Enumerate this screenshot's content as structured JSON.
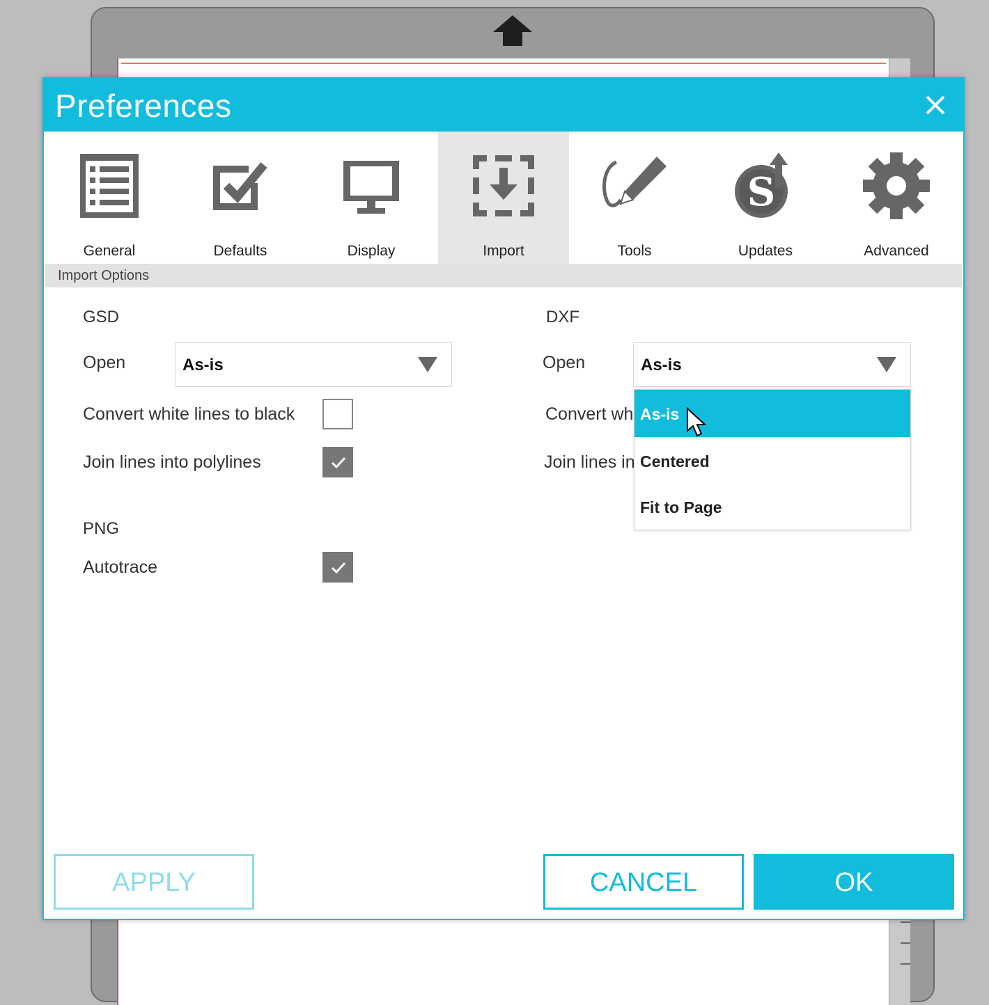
{
  "colors": {
    "accent": "#12bcdc",
    "accent_light": "#8edcec",
    "checkbox_checked": "#777777"
  },
  "dialog": {
    "title": "Preferences",
    "close_icon": "close-icon"
  },
  "tabs": [
    {
      "label": "General",
      "icon": "list-icon",
      "active": false
    },
    {
      "label": "Defaults",
      "icon": "checkmark-box-icon",
      "active": false
    },
    {
      "label": "Display",
      "icon": "monitor-icon",
      "active": false
    },
    {
      "label": "Import",
      "icon": "import-icon",
      "active": true
    },
    {
      "label": "Tools",
      "icon": "pen-tool-icon",
      "active": false
    },
    {
      "label": "Updates",
      "icon": "updates-icon",
      "active": false
    },
    {
      "label": "Advanced",
      "icon": "gear-icon",
      "active": false
    }
  ],
  "section": {
    "label": "Import Options"
  },
  "gsd": {
    "heading": "GSD",
    "open_label": "Open",
    "open_value": "As-is",
    "convert_label": "Convert white lines to black",
    "convert_checked": false,
    "join_label": "Join lines into polylines",
    "join_checked": true
  },
  "png": {
    "heading": "PNG",
    "autotrace_label": "Autotrace",
    "autotrace_checked": true
  },
  "dxf": {
    "heading": "DXF",
    "open_label": "Open",
    "open_value": "As-is",
    "convert_label_visible": "Convert wh",
    "join_label_visible": "Join lines in",
    "dropdown_options": [
      "As-is",
      "Centered",
      "Fit to Page"
    ],
    "dropdown_selected": "As-is"
  },
  "footer": {
    "apply_label": "APPLY",
    "cancel_label": "CANCEL",
    "ok_label": "OK"
  }
}
